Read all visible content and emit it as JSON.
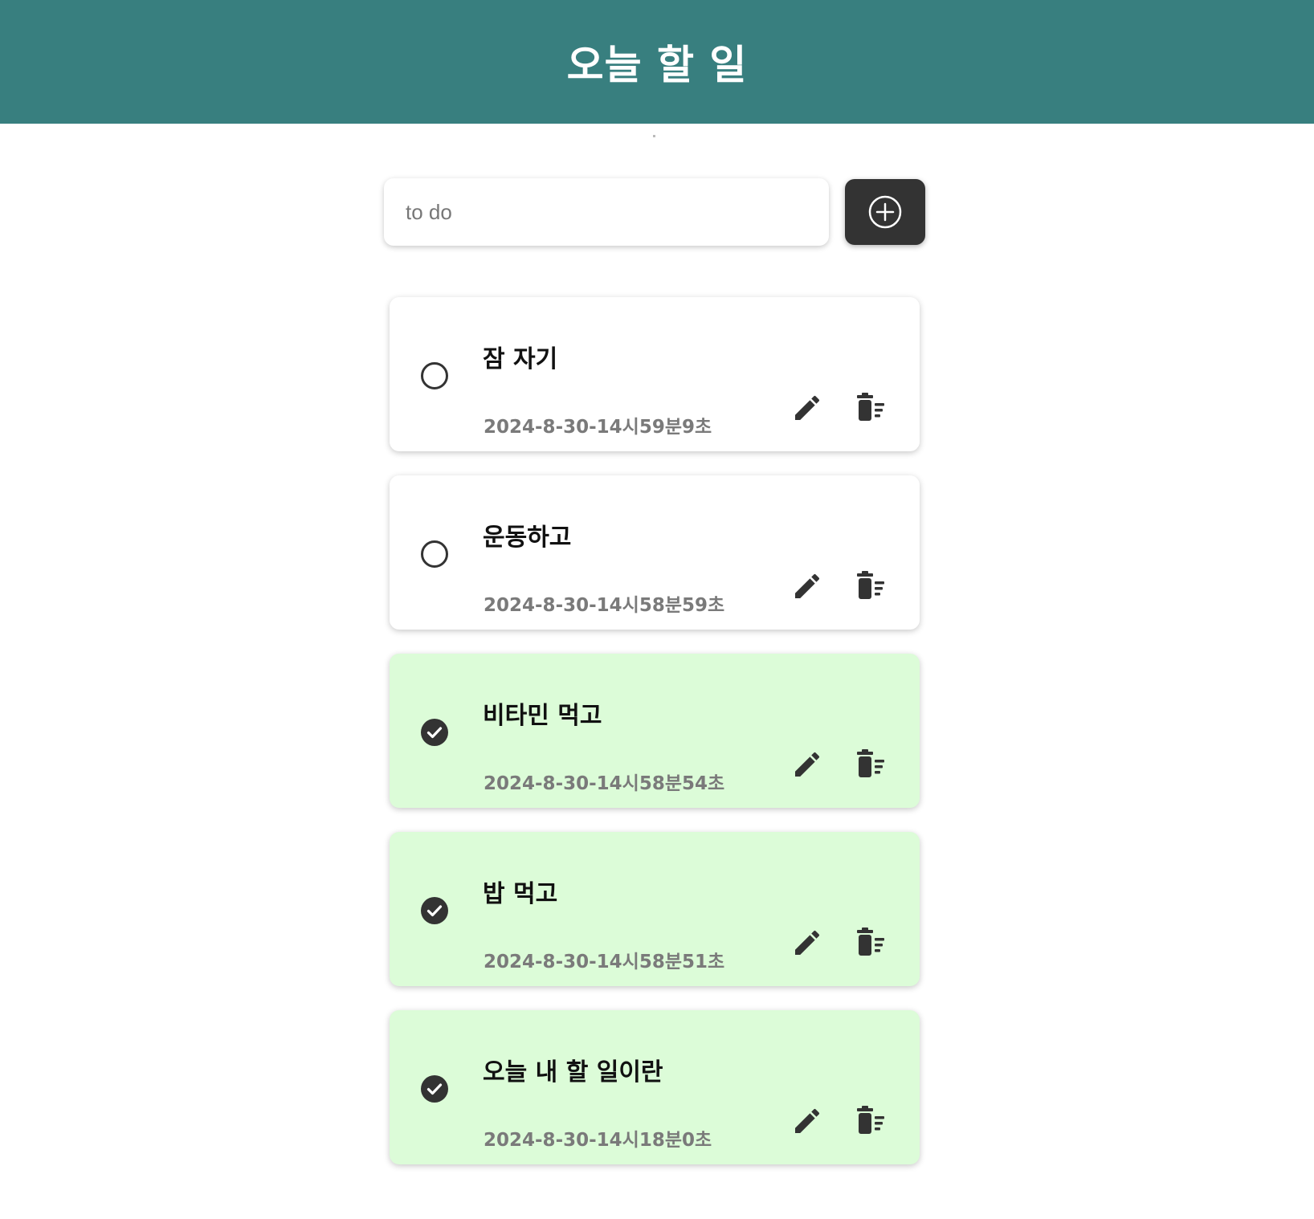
{
  "header": {
    "title": "오늘 할 일"
  },
  "input": {
    "placeholder": "to do",
    "value": ""
  },
  "add_button": {
    "icon": "plus-circle-icon"
  },
  "colors": {
    "header_bg": "#387f7f",
    "done_bg": "#dcfcd8",
    "button_bg": "#333333",
    "date_text": "#7a7a7a"
  },
  "todos": [
    {
      "title": "잠 자기",
      "date": "2024-8-30-14시59분9초",
      "done": false
    },
    {
      "title": "운동하고",
      "date": "2024-8-30-14시58분59초",
      "done": false
    },
    {
      "title": "비타민 먹고",
      "date": "2024-8-30-14시58분54초",
      "done": true
    },
    {
      "title": "밥 먹고",
      "date": "2024-8-30-14시58분51초",
      "done": true
    },
    {
      "title": "오늘 내 할 일이란",
      "date": "2024-8-30-14시18분0초",
      "done": true
    }
  ],
  "item_icons": {
    "edit": "pencil-icon",
    "delete": "trash-icon",
    "unchecked": "circle-icon",
    "checked": "check-circle-icon"
  }
}
